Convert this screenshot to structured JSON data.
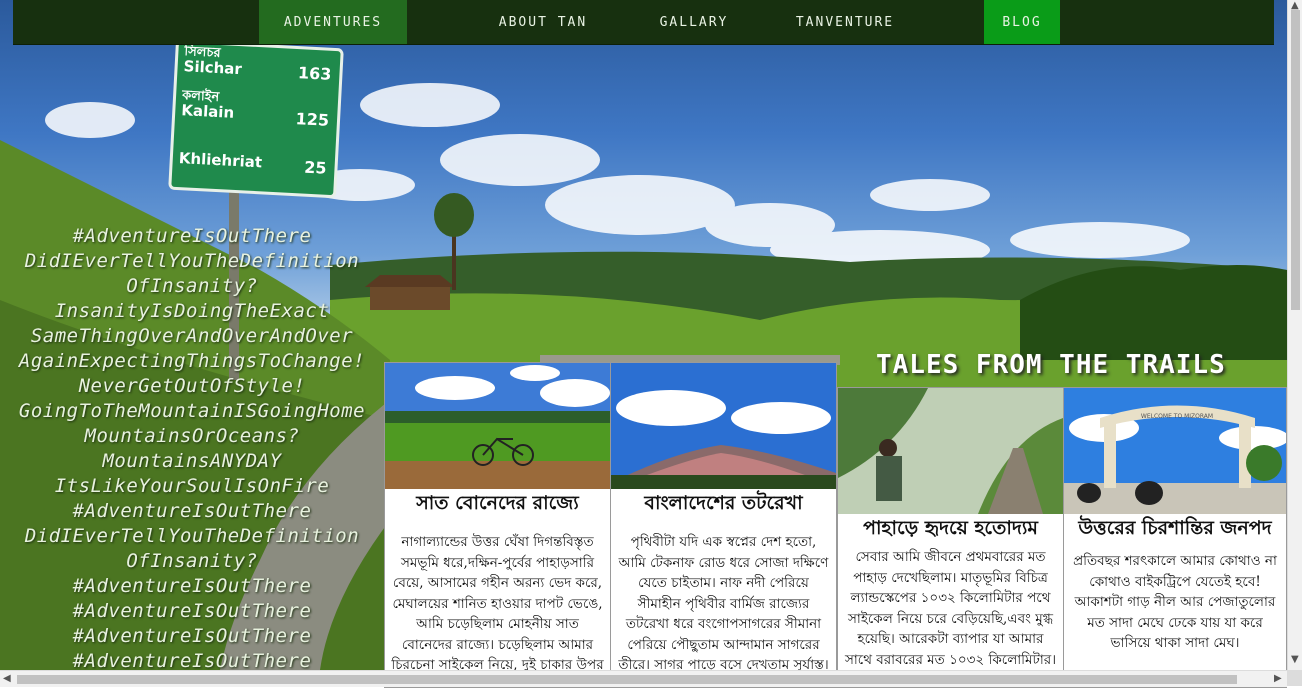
{
  "nav": {
    "items": [
      {
        "label": "ADVENTURES"
      },
      {
        "label": "ABOUT TAN"
      },
      {
        "label": "GALLARY"
      },
      {
        "label": "TANVENTURE"
      },
      {
        "label": "BLOG"
      }
    ]
  },
  "sign": {
    "rows": [
      {
        "place_bn": "সিলচর",
        "place": "Silchar",
        "km": "163"
      },
      {
        "place_bn": "কলাইন",
        "place": "Kalain",
        "km": "125"
      },
      {
        "place": "Khliehriat",
        "km": "25"
      }
    ]
  },
  "hashtags": [
    "#AdventureIsOutThere",
    "DidIEverTellYouTheDefinition",
    "OfInsanity?",
    "InsanityIsDoingTheExact",
    "SameThingOverAndOverAndOver",
    "AgainExpectingThingsToChange!",
    "NeverGetOutOfStyle!",
    "GoingToTheMountainISGoingHome",
    "MountainsOrOceans?",
    "MountainsANYDAY",
    "ItsLikeYourSoulIsOnFire",
    "#AdventureIsOutThere",
    "DidIEverTellYouTheDefinition",
    "OfInsanity?",
    "#AdventureIsOutThere",
    "#AdventureIsOutThere",
    "#AdventureIsOutThere",
    "#AdventureIsOutThere"
  ],
  "section_title": "TALES FROM THE TRAILS",
  "arch_text": "WELCOME TO MIZORAM",
  "cards": [
    {
      "title": "সাত বোনেদের রাজ্যে",
      "text": "নাগাল্যান্ডের উত্তর ঘেঁষা দিগন্তবিস্তৃত সমভূমি ধরে,দক্ষিন-পুর্বের পাহাড়সারি বেয়ে, আসামের গহীন অরন্য ভেদ করে, মেঘালয়ের শানিত হাওয়ার দাপট ভেঙে, আমি চড়েছিলাম মোহনীয় সাত বোনেদের রাজ্যে। চড়েছিলাম আমার চিরচেনা সাইকেল নিয়ে, দুই চাকার উপর ভর করে।"
    },
    {
      "title": "বাংলাদেশের তটরেখা",
      "text": "পৃথিবীটা যদি এক স্বপ্নের দেশ হতো, আমি টেকনাফ রোড ধরে সোজা দক্ষিণে যেতে চাইতাম। নাফ নদী পেরিয়ে সীমাহীন পৃথিবীর বার্মিজ রাজ্যের তটরেখা ধরে বংগোপসাগরের সীমানা পেরিয়ে পৌছুতাম আন্দামান সাগরের তীরে। সাগর পাড়ে বসে দেখতাম সূর্যাস্ত।"
    },
    {
      "title": "পাহাড়ে হৃদয়ে হতোদ্যম",
      "text": "সেবার আমি জীবনে প্রথমবারের মত পাহাড় দেখেছিলাম। মাতৃভূমির বিচিত্র ল্যান্ডস্কেপের ১০৩২ কিলোমিটার পথে সাইকেল নিয়ে চরে বেড়িয়েছি,এবং মুগ্ধ হয়েছি। আরেকটা ব্যাপার যা আমার সাথে বরাবরের মত ১০৩২ কিলোমিটার।"
    },
    {
      "title": "উত্তরের চিরশান্তির জনপদ",
      "text": "প্রতিবছর শরৎকালে আমার কোথাও না কোথাও বাইকট্রিপে যেতেই হবে! আকাশটা গাড় নীল আর পেজাতুলোর মত সাদা মেঘে ঢেকে যায় যা করে ভাসিয়ে থাকা সাদা মেঘ।"
    }
  ]
}
